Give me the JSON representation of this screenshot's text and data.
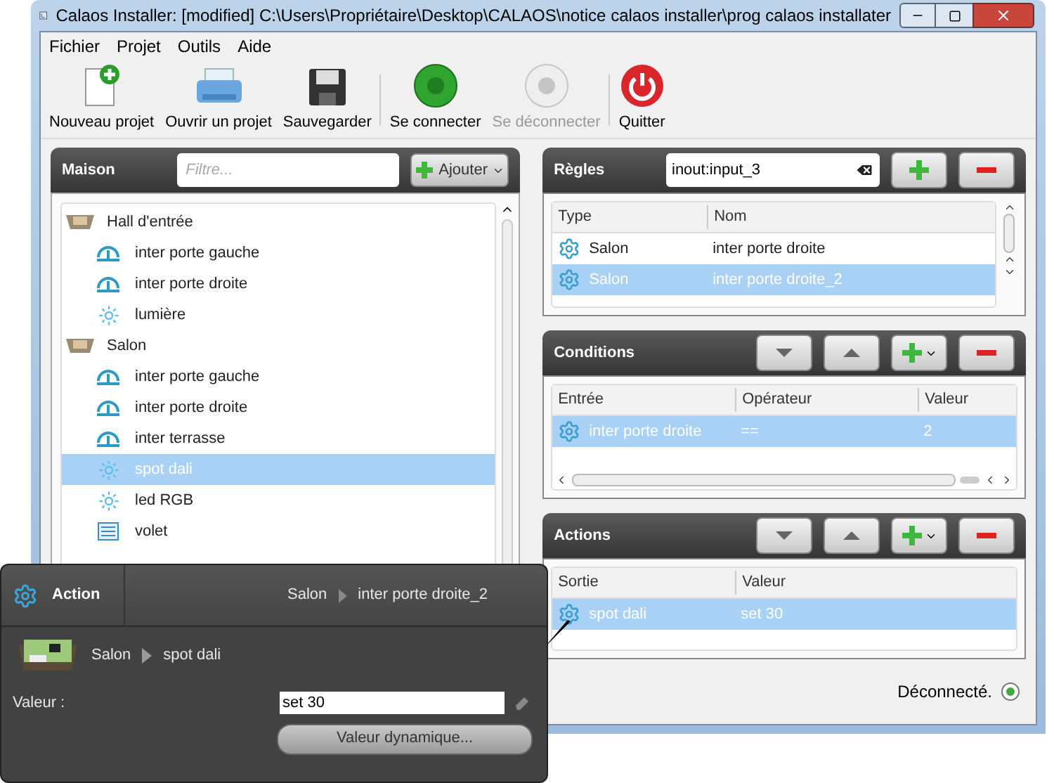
{
  "window": {
    "title": "Calaos Installer: [modified] C:\\Users\\Propriétaire\\Desktop\\CALAOS\\notice calaos installer\\prog calaos installater"
  },
  "menu": [
    "Fichier",
    "Projet",
    "Outils",
    "Aide"
  ],
  "toolbar": [
    {
      "label": "Nouveau projet",
      "kind": "new",
      "disabled": false
    },
    {
      "label": "Ouvrir un projet",
      "kind": "open",
      "disabled": false
    },
    {
      "label": "Sauvegarder",
      "kind": "save",
      "disabled": false
    },
    {
      "label": "Se connecter",
      "kind": "connect",
      "disabled": false
    },
    {
      "label": "Se déconnecter",
      "kind": "disconnect",
      "disabled": true
    },
    {
      "label": "Quitter",
      "kind": "quit",
      "disabled": false
    }
  ],
  "house_panel": {
    "title": "Maison",
    "filter": {
      "placeholder": "Filtre..."
    },
    "add_button": "Ajouter",
    "tree": [
      {
        "label": "Hall d'entrée",
        "kind": "room",
        "selected": false,
        "children": [
          {
            "label": "inter porte gauche",
            "kind": "switch",
            "selected": false
          },
          {
            "label": "inter porte droite",
            "kind": "switch",
            "selected": false
          },
          {
            "label": "lumière",
            "kind": "light",
            "selected": false
          }
        ]
      },
      {
        "label": "Salon",
        "kind": "room",
        "selected": false,
        "children": [
          {
            "label": "inter porte gauche",
            "kind": "switch",
            "selected": false
          },
          {
            "label": "inter porte droite",
            "kind": "switch",
            "selected": false
          },
          {
            "label": "inter terrasse",
            "kind": "switch",
            "selected": false
          },
          {
            "label": "spot dali",
            "kind": "light",
            "selected": true
          },
          {
            "label": "led RGB",
            "kind": "light",
            "selected": false
          },
          {
            "label": "volet",
            "kind": "shutter",
            "selected": false
          }
        ]
      }
    ]
  },
  "rules_panel": {
    "title": "Règles",
    "search": {
      "value": "inout:input_3"
    },
    "columns": [
      "Type",
      "Nom"
    ],
    "rows": [
      {
        "type": "Salon",
        "name": "inter porte droite",
        "selected": false
      },
      {
        "type": "Salon",
        "name": "inter porte droite_2",
        "selected": true
      }
    ]
  },
  "conditions_panel": {
    "title": "Conditions",
    "columns": [
      "Entrée",
      "Opérateur",
      "Valeur"
    ],
    "rows": [
      {
        "input": "inter porte droite",
        "operator": "==",
        "value": "2",
        "selected": true
      }
    ]
  },
  "actions_panel": {
    "title": "Actions",
    "columns": [
      "Sortie",
      "Valeur"
    ],
    "rows": [
      {
        "output": "spot dali",
        "value": "set 30",
        "selected": true
      }
    ]
  },
  "status": "Déconnecté.",
  "action_popup": {
    "title": "Action",
    "breadcrumb": [
      "Salon",
      "inter porte droite_2"
    ],
    "target": [
      "Salon",
      "spot dali"
    ],
    "value_label": "Valeur :",
    "value": "set 30",
    "dynamic_button": "Valeur dynamique..."
  }
}
